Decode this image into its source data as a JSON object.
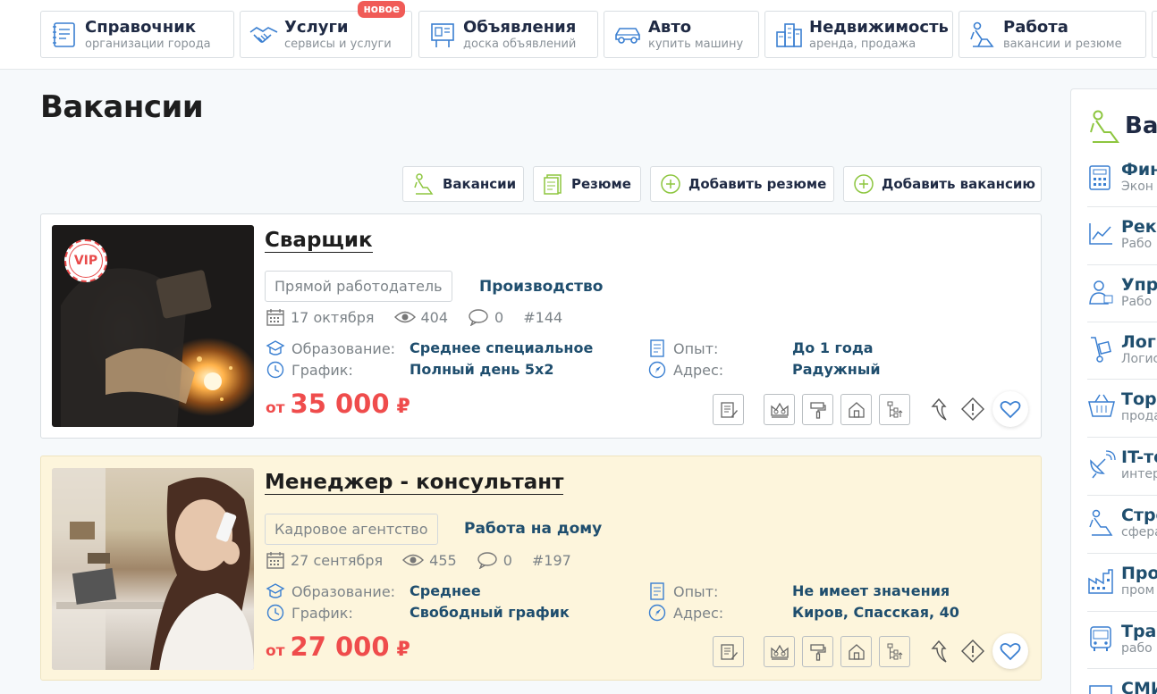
{
  "nav": [
    {
      "title": "Справочник",
      "subtitle": "организации города"
    },
    {
      "title": "Услуги",
      "subtitle": "сервисы и услуги",
      "badge": "новое"
    },
    {
      "title": "Объявления",
      "subtitle": "доска объявлений"
    },
    {
      "title": "Авто",
      "subtitle": "купить машину"
    },
    {
      "title": "Недвижимость",
      "subtitle": "аренда, продажа"
    },
    {
      "title": "Работа",
      "subtitle": "вакансии и резюме"
    }
  ],
  "page_title": "Вакансии",
  "actions": {
    "vacancies": "Вакансии",
    "resumes": "Резюме",
    "add_resume": "Добавить резюме",
    "add_vacancy": "Добавить вакансию"
  },
  "listings": [
    {
      "title": "Сварщик",
      "vip": "VIP",
      "employer_type": "Прямой работодатель",
      "category": "Производство",
      "date": "17 октября",
      "views": "404",
      "comments": "0",
      "id": "#144",
      "education_label": "Образование:",
      "education": "Среднее специальное",
      "schedule_label": "График:",
      "schedule": "Полный день 5х2",
      "experience_label": "Опыт:",
      "experience": "До 1 года",
      "address_label": "Адрес:",
      "address": "Радужный",
      "price_from": "от",
      "price": "35 000",
      "currency": "₽"
    },
    {
      "title": "Менеджер - консультант",
      "employer_type": "Кадровое агентство",
      "category": "Работа на дому",
      "date": "27 сентября",
      "views": "455",
      "comments": "0",
      "id": "#197",
      "education_label": "Образование:",
      "education": "Среднее",
      "schedule_label": "График:",
      "schedule": "Свободный график",
      "experience_label": "Опыт:",
      "experience": "Не имеет значения",
      "address_label": "Адрес:",
      "address": "Киров, Спасская, 40",
      "price_from": "от",
      "price": "27 000",
      "currency": "₽"
    }
  ],
  "sidebar": {
    "title": "Ва",
    "items": [
      {
        "label": "Фин",
        "sub": "Экон"
      },
      {
        "label": "Рекл",
        "sub": "Рабо"
      },
      {
        "label": "Упра",
        "sub": "Рабо"
      },
      {
        "label": "Логи",
        "sub": "Логис"
      },
      {
        "label": "Торг",
        "sub": "прода"
      },
      {
        "label": "IT-те",
        "sub": "интер"
      },
      {
        "label": "Стро",
        "sub": "сфера"
      },
      {
        "label": "Про",
        "sub": "пром"
      },
      {
        "label": "Тран",
        "sub": "рабо"
      },
      {
        "label": "СМИ",
        "sub": ""
      }
    ]
  },
  "colors": {
    "accent_price": "#ef4c4c",
    "link": "#1f4e6e",
    "badge": "#f05b57",
    "highlight_bg": "#fdf5dc",
    "icon_blue": "#3a7fd1",
    "icon_green": "#8dc63f"
  }
}
